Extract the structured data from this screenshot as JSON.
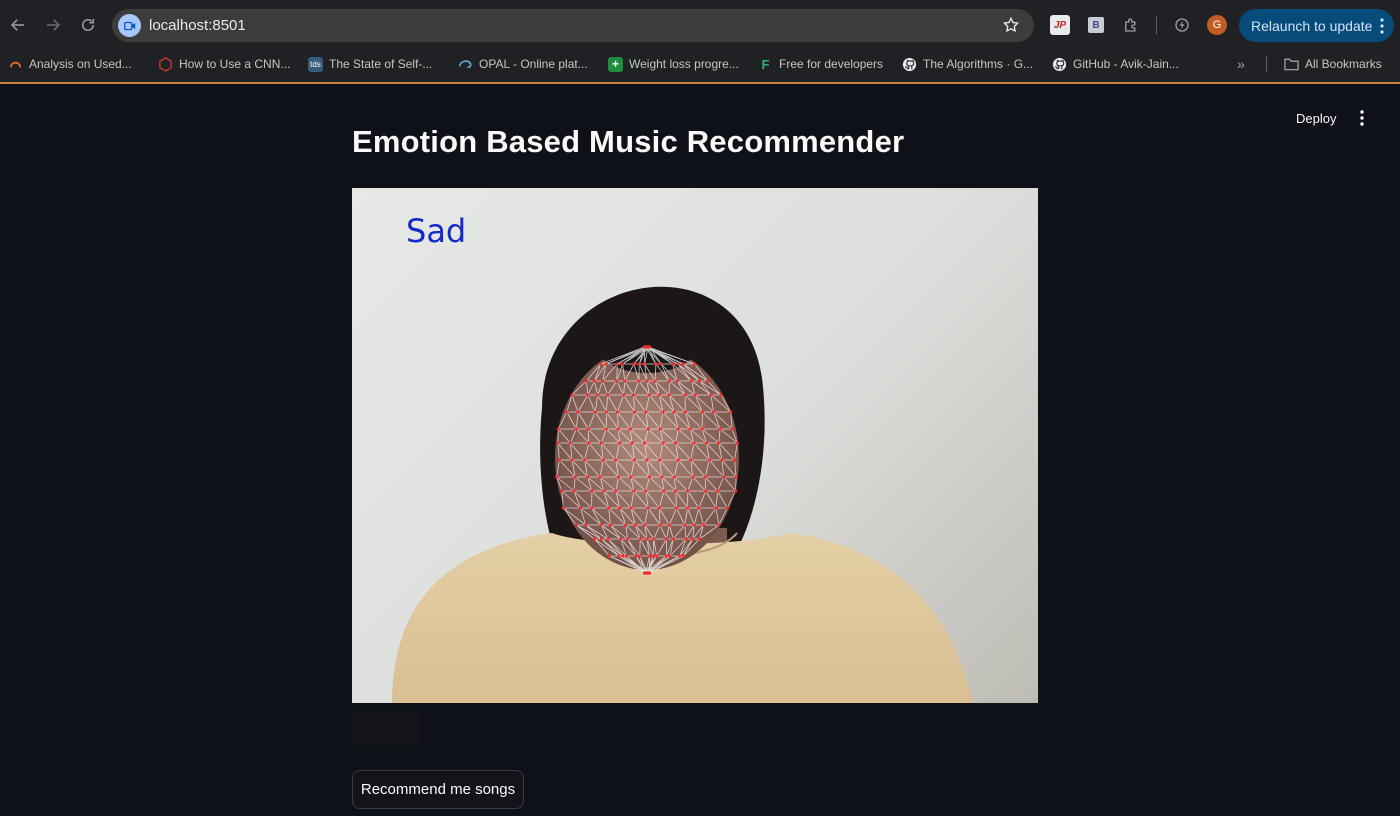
{
  "browser": {
    "url": "localhost:8501",
    "relaunch_label": "Relaunch to update",
    "profile_initial": "G",
    "bookmarks": [
      {
        "label": "Analysis on Used...",
        "icon": "analysis-icon"
      },
      {
        "label": "How to Use a CNN...",
        "icon": "cube-icon"
      },
      {
        "label": "The State of Self-...",
        "icon": "tds-icon"
      },
      {
        "label": "OPAL - Online plat...",
        "icon": "opal-icon"
      },
      {
        "label": "Weight loss progre...",
        "icon": "sheets-icon"
      },
      {
        "label": "Free for developers",
        "icon": "f-icon"
      },
      {
        "label": "The Algorithms · G...",
        "icon": "github-icon"
      },
      {
        "label": "GitHub - Avik-Jain...",
        "icon": "github-icon"
      }
    ],
    "all_bookmarks_label": "All Bookmarks"
  },
  "app": {
    "title": "Emotion Based Music Recommender",
    "deploy_label": "Deploy",
    "detected_emotion": "Sad",
    "recommend_button": "Recommend me songs"
  },
  "colors": {
    "app_bg": "#0e1117",
    "chrome_bg": "#202124",
    "relaunch_bg": "#064b7a",
    "emotion_text": "#1528c9",
    "mesh_point": "#ff2a2a"
  }
}
